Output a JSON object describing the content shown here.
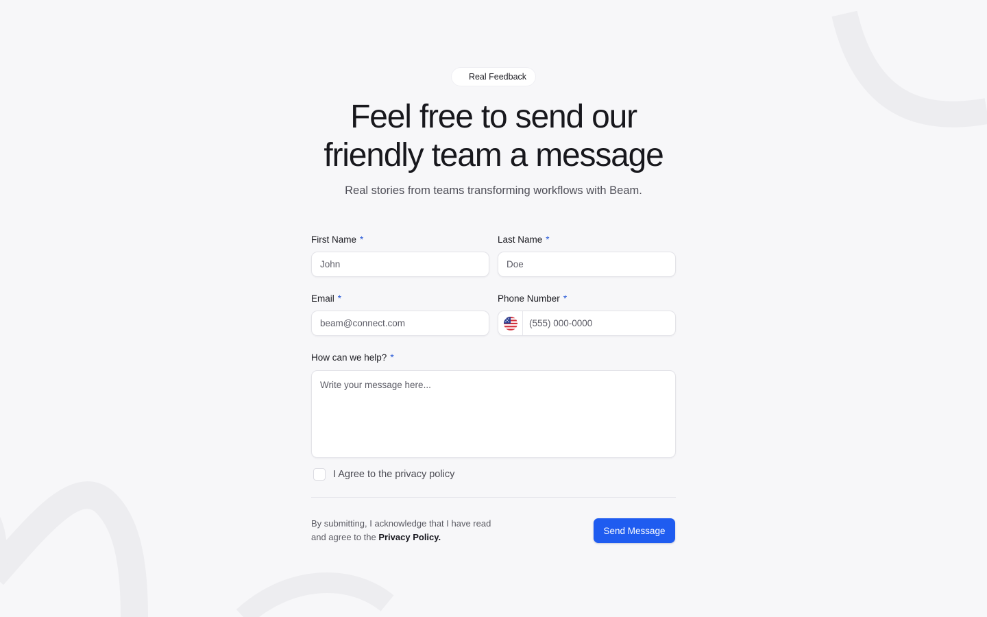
{
  "hero": {
    "badge": "Real Feedback",
    "title_line1": "Feel free to send our",
    "title_line2": "friendly team a message",
    "subtitle": "Real stories from teams transforming workflows with Beam."
  },
  "form": {
    "required_marker": "*",
    "first_name": {
      "label": "First Name",
      "placeholder": "John"
    },
    "last_name": {
      "label": "Last Name",
      "placeholder": "Doe"
    },
    "email": {
      "label": "Email",
      "placeholder": "beam@connect.com"
    },
    "phone": {
      "label": "Phone Number",
      "placeholder": "(555) 000-0000",
      "country_flag": "us-flag-icon"
    },
    "message": {
      "label": "How can we help?",
      "placeholder": "Write your message here..."
    },
    "agree_label": "I Agree to the privacy policy",
    "legal_text": "By submitting, I acknowledge that I have read and agree to the",
    "legal_link": "Privacy Policy.",
    "submit_label": "Send Message"
  },
  "colors": {
    "background": "#f7f7f9",
    "accent": "#1f5cf0",
    "required": "#2a5bd7",
    "decoration": "#ededf0"
  }
}
